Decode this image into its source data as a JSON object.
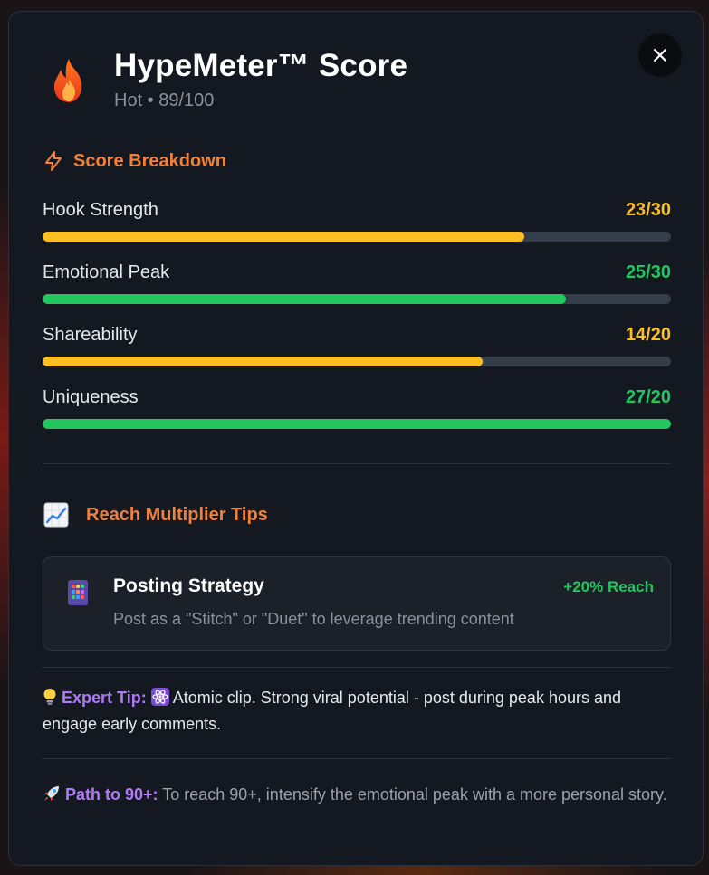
{
  "header": {
    "title": "HypeMeter™ Score",
    "subtitle": "Hot • 89/100"
  },
  "breakdown": {
    "heading": "Score Breakdown",
    "metrics": [
      {
        "name": "Hook Strength",
        "value_text": "23/30",
        "fraction": 0.767,
        "color": "#fbbf24"
      },
      {
        "name": "Emotional Peak",
        "value_text": "25/30",
        "fraction": 0.833,
        "color": "#22c55e"
      },
      {
        "name": "Shareability",
        "value_text": "14/20",
        "fraction": 0.7,
        "color": "#fbbf24"
      },
      {
        "name": "Uniqueness",
        "value_text": "27/20",
        "fraction": 1.0,
        "color": "#22c55e"
      }
    ]
  },
  "tips": {
    "heading": "Reach Multiplier Tips",
    "card": {
      "title": "Posting Strategy",
      "badge": "+20% Reach",
      "description": "Post as a \"Stitch\" or \"Duet\" to leverage trending content"
    }
  },
  "expert_tip": {
    "label": "Expert Tip:",
    "text": "Atomic clip. Strong viral potential - post during peak hours and engage early comments."
  },
  "path": {
    "label": "Path to 90+:",
    "text": "To reach 90+, intensify the emotional peak with a more personal story."
  },
  "icons": {
    "header": "fire-icon",
    "breakdown": "lightning-icon",
    "tips": "chart-increasing-icon",
    "card": "calculator-icon",
    "expert": "lightbulb-icon",
    "atom": "atom-icon",
    "path": "rocket-icon",
    "close": "close-icon"
  },
  "colors": {
    "accent_orange": "#f0813a",
    "yellow": "#fbbf24",
    "green": "#22c55e",
    "purple": "#b07af5"
  }
}
